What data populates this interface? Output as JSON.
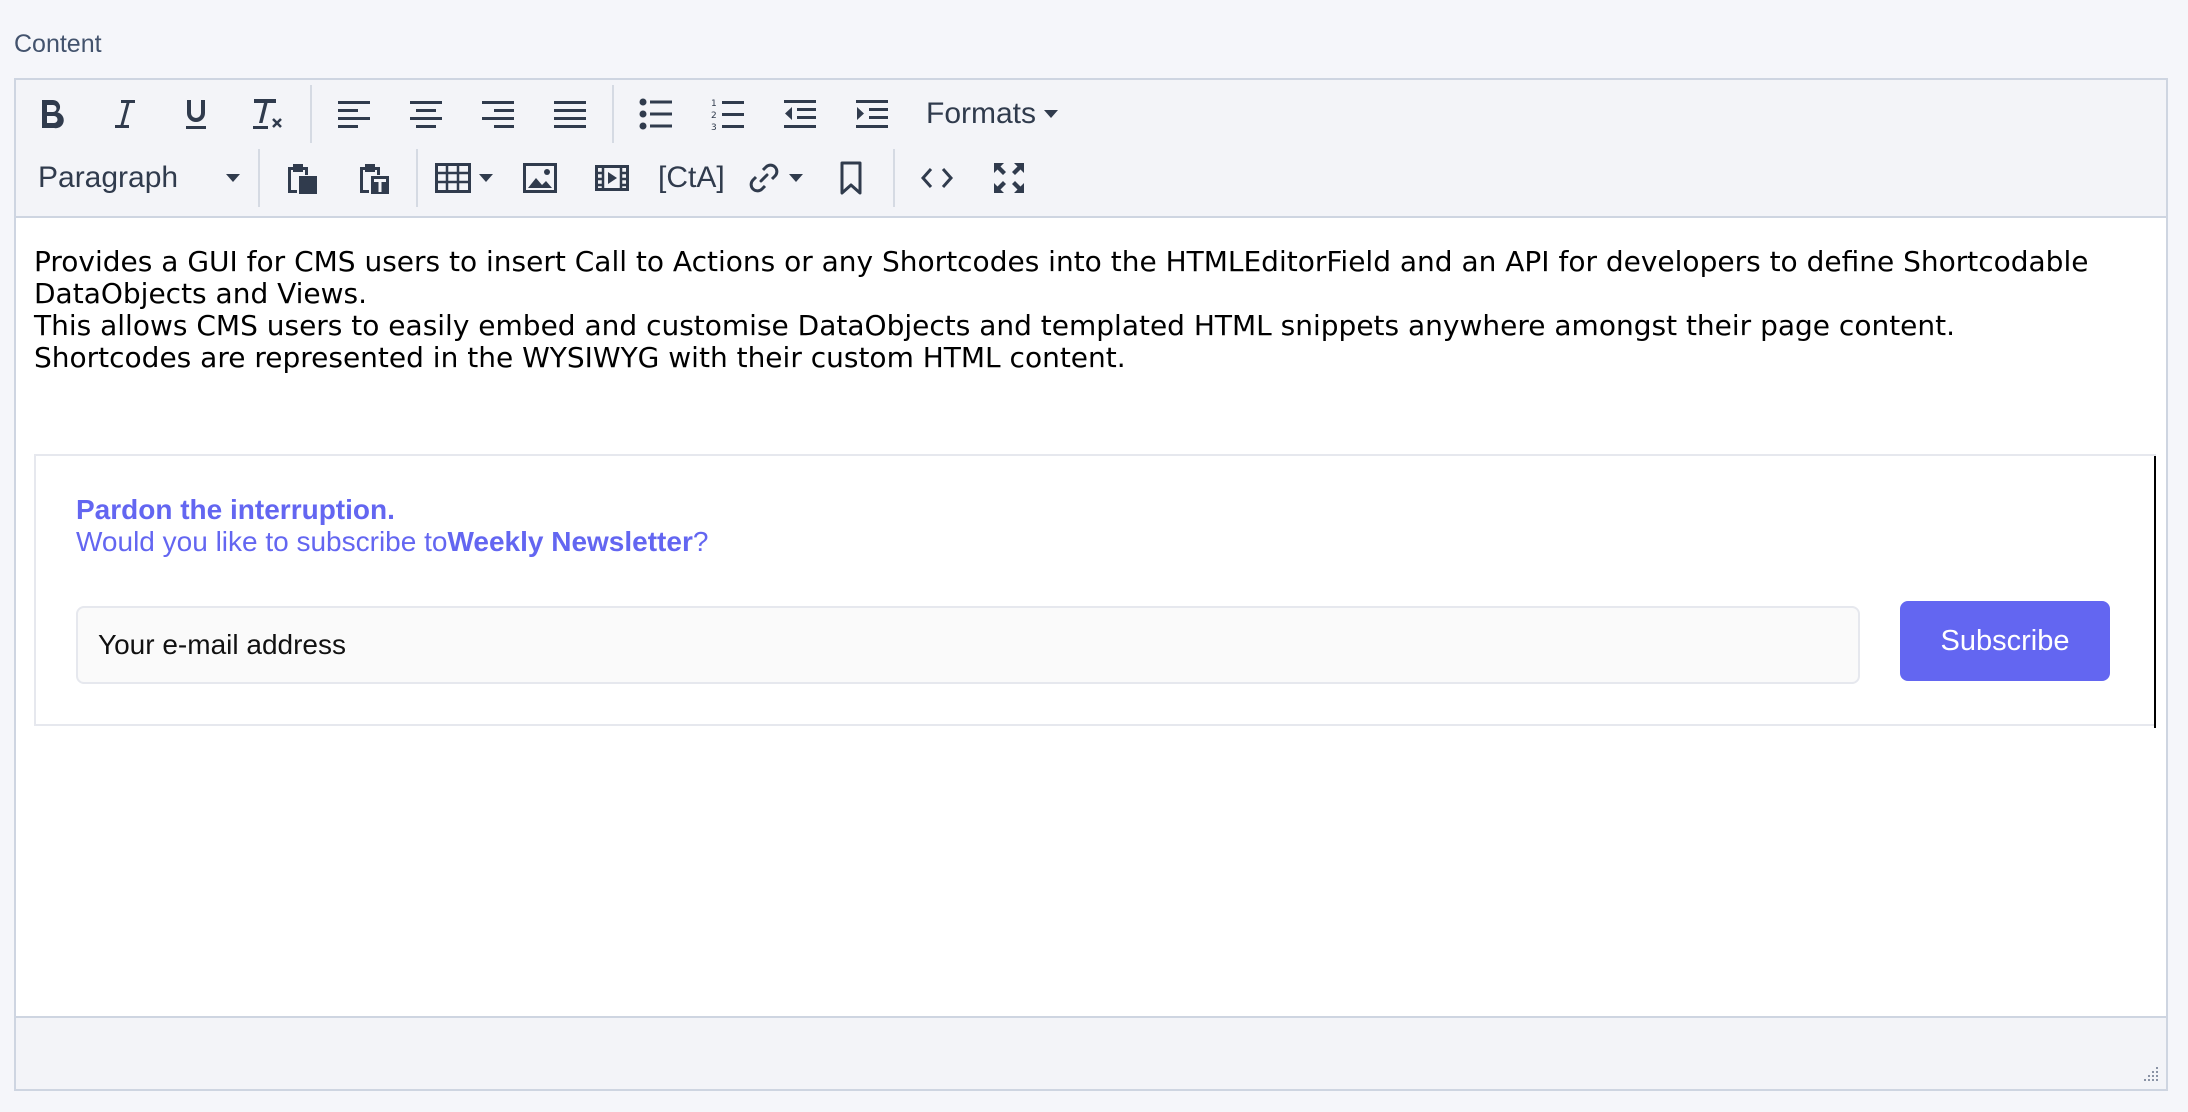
{
  "field": {
    "label": "Content"
  },
  "toolbar": {
    "formats_label": "Formats",
    "block_format": "Paragraph",
    "cta_label": "[CtA]"
  },
  "content": {
    "paragraph_lines": [
      "Provides a GUI for CMS users to insert Call to Actions or any Shortcodes into the HTMLEditorField and an API for developers to define Shortcodable DataObjects and Views.",
      "This allows CMS users to easily embed and customise DataObjects and templated HTML snippets anywhere amongst their page content.",
      "Shortcodes are represented in the WYSIWYG with their custom HTML content."
    ]
  },
  "cta": {
    "heading": "Pardon the interruption.",
    "prompt_prefix": "Would you like to subscribe to",
    "newsletter_name": "Weekly Newsletter",
    "prompt_suffix": "?",
    "email_placeholder": "Your e-mail address",
    "subscribe_label": "Subscribe",
    "accent_color": "#6366f1"
  }
}
